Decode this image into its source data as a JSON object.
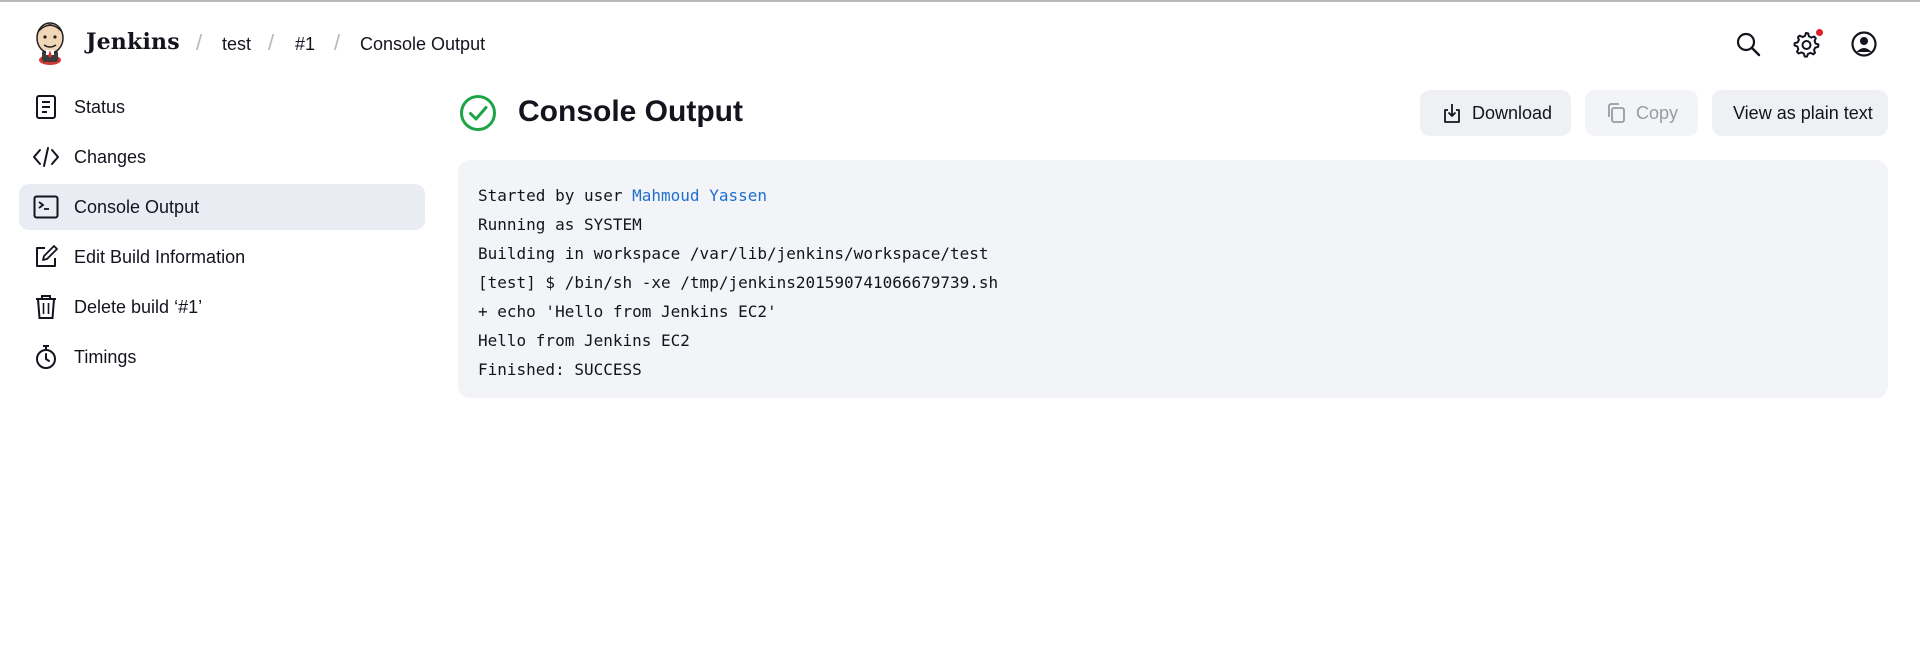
{
  "header": {
    "brand": "Jenkins",
    "breadcrumbs": [
      "test",
      "#1",
      "Console Output"
    ],
    "separator": "/",
    "icons": [
      "search-icon",
      "settings-icon",
      "user-icon"
    ],
    "notification_color": "#e11d2b"
  },
  "sidebar": {
    "items": [
      {
        "label": "Status",
        "icon": "status-icon",
        "active": false
      },
      {
        "label": "Changes",
        "icon": "code-icon",
        "active": false
      },
      {
        "label": "Console Output",
        "icon": "terminal-icon",
        "active": true
      },
      {
        "label": "Edit Build Information",
        "icon": "edit-icon",
        "active": false
      },
      {
        "label": "Delete build ‘#1’",
        "icon": "trash-icon",
        "active": false
      },
      {
        "label": "Timings",
        "icon": "stopwatch-icon",
        "active": false
      }
    ]
  },
  "main": {
    "title": "Console Output",
    "status_icon": "success-check-icon",
    "status_color": "#1ea446",
    "buttons": {
      "download": "Download",
      "copy": "Copy",
      "plain_text": "View as plain text"
    },
    "console": {
      "started_prefix": "Started by user ",
      "user": "Mahmoud Yassen",
      "lines": [
        "Running as SYSTEM",
        "Building in workspace /var/lib/jenkins/workspace/test",
        "[test] $ /bin/sh -xe /tmp/jenkins201590741066679739.sh",
        "+ echo 'Hello from Jenkins EC2'",
        "Hello from Jenkins EC2",
        "Finished: SUCCESS"
      ]
    }
  },
  "colors": {
    "link": "#1f6fd0",
    "active_bg": "#e9ecf2",
    "console_bg": "#f2f4f7",
    "button_bg": "#eef0f4"
  }
}
